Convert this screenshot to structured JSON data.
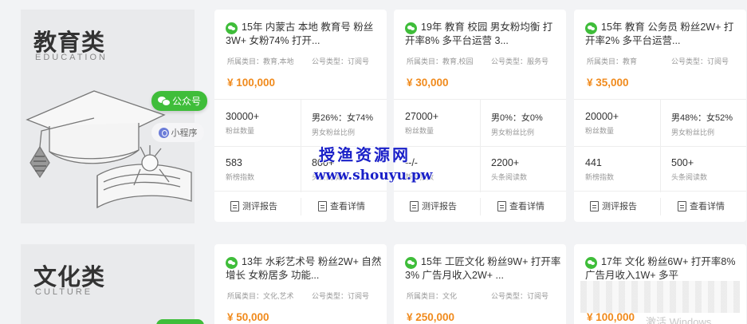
{
  "sections": [
    {
      "title": "教育类",
      "title_en": "EDUCATION",
      "badges": {
        "gzh": "公众号",
        "xcx": "小程序"
      },
      "cards": [
        {
          "title": "15年 内蒙古 本地 教育号 粉丝3W+ 女粉74% 打开...",
          "category": "所属类目：教育,本地",
          "type": "公号类型：订阅号",
          "price": "¥ 100,000",
          "stats": [
            {
              "value": "30000+",
              "label": "粉丝数量"
            },
            {
              "value": "男26%：女74%",
              "label": "男女粉丝比例"
            },
            {
              "value": "583",
              "label": "新榜指数"
            },
            {
              "value": "800+",
              "label": "头条阅读数"
            }
          ],
          "actions": {
            "report": "测评报告",
            "detail": "查看详情"
          }
        },
        {
          "title": "19年 教育 校园 男女粉均衡 打开率8% 多平台运营 3...",
          "category": "所属类目：教育,校园",
          "type": "公号类型：服务号",
          "price": "¥ 30,000",
          "stats": [
            {
              "value": "27000+",
              "label": "粉丝数量"
            },
            {
              "value": "男0%：女0%",
              "label": "男女粉丝比例"
            },
            {
              "value": "--/-",
              "label": "新榜指数"
            },
            {
              "value": "2200+",
              "label": "头条阅读数"
            }
          ],
          "actions": {
            "report": "测评报告",
            "detail": "查看详情"
          }
        },
        {
          "title": "15年 教育 公务员 粉丝2W+ 打开率2% 多平台运营...",
          "category": "所属类目：教育",
          "type": "公号类型：订阅号",
          "price": "¥ 35,000",
          "stats": [
            {
              "value": "20000+",
              "label": "粉丝数量"
            },
            {
              "value": "男48%：女52%",
              "label": "男女粉丝比例"
            },
            {
              "value": "441",
              "label": "新榜指数"
            },
            {
              "value": "500+",
              "label": "头条阅读数"
            }
          ],
          "actions": {
            "report": "测评报告",
            "detail": "查看详情"
          }
        }
      ]
    },
    {
      "title": "文化类",
      "title_en": "CULTURE",
      "cards": [
        {
          "title": "13年 水彩艺术号 粉丝2W+ 自然增长 女粉居多 功能...",
          "category": "所属类目：文化,艺术",
          "type": "公号类型：订阅号",
          "price": "¥ 50,000"
        },
        {
          "title": "15年 工匠文化 粉丝9W+ 打开率3% 广告月收入2W+ ...",
          "category": "所属类目：文化",
          "type": "公号类型：订阅号",
          "price": "¥ 250,000"
        },
        {
          "title": "17年 文化 粉丝6W+ 打开率8% 广告月收入1W+ 多平",
          "category": "",
          "type": "",
          "price": "¥ 100,000"
        }
      ]
    }
  ],
  "watermark": {
    "line1": "授渔资源网",
    "line2": "www.shouyu.pw"
  },
  "os_overlay": "激活 Windows",
  "colors": {
    "accent_green": "#3fbd3a",
    "price_orange": "#f08a1c",
    "watermark_blue": "#1a20c8"
  }
}
